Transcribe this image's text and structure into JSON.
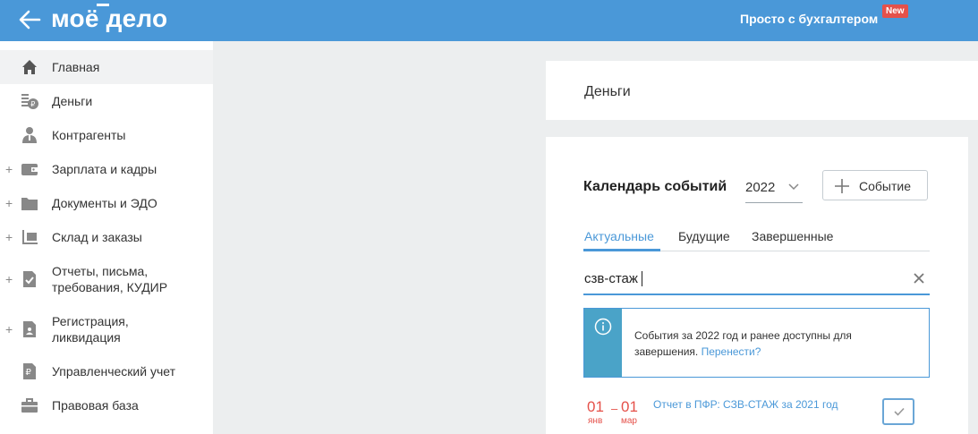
{
  "header": {
    "logo": "моё дело",
    "link": "Просто с бухгалтером",
    "badge": "New"
  },
  "sidebar": {
    "items": [
      {
        "label": "Главная",
        "icon": "home-icon",
        "expandable": false,
        "active": true
      },
      {
        "label": "Деньги",
        "icon": "money-icon",
        "expandable": false
      },
      {
        "label": "Контрагенты",
        "icon": "contractor-icon",
        "expandable": false
      },
      {
        "label": "Зарплата и кадры",
        "icon": "wallet-icon",
        "expandable": true
      },
      {
        "label": "Документы и ЭДО",
        "icon": "folder-icon",
        "expandable": true
      },
      {
        "label": "Склад и заказы",
        "icon": "warehouse-icon",
        "expandable": true
      },
      {
        "label": "Отчеты, письма, требования, КУДИР",
        "icon": "report-icon",
        "expandable": true
      },
      {
        "label": "Регистрация, ликвидация",
        "icon": "registration-icon",
        "expandable": true
      },
      {
        "label": "Управленческий учет",
        "icon": "ruble-doc-icon",
        "expandable": false
      },
      {
        "label": "Правовая база",
        "icon": "briefcase-icon",
        "expandable": false
      }
    ],
    "plus": "+"
  },
  "main": {
    "section_title": "Деньги",
    "calendar": {
      "title": "Календарь событий",
      "year": "2022",
      "add_button": "Событие",
      "tabs": [
        "Актуальные",
        "Будущие",
        "Завершенные"
      ],
      "active_tab": 0,
      "search_value": "сзв-стаж",
      "info_text": "События за 2022 год и ранее доступны для завершения.",
      "info_link": "Перенести?",
      "event": {
        "from_day": "01",
        "from_month": "янв",
        "dash": "–",
        "to_day": "01",
        "to_month": "мар",
        "title": "Отчет в ПФР: СЗВ-СТАЖ за 2021 год"
      }
    }
  },
  "colors": {
    "header": "#4a98d8",
    "accent": "#4a98d8",
    "danger": "#e5514a",
    "info_side": "#4aa3c8"
  }
}
